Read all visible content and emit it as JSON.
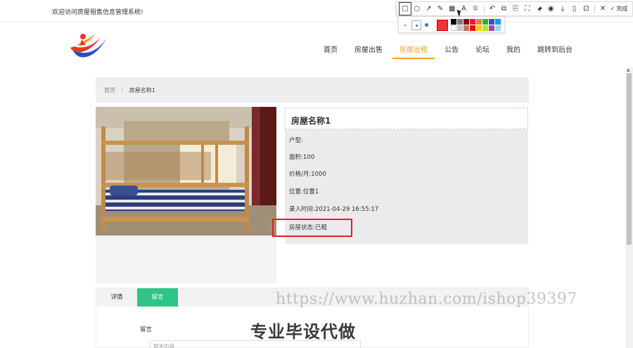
{
  "topbar": {
    "welcome": "欢迎访问房屋租售信息管理系统!"
  },
  "annotation_toolbar": {
    "tools": [
      {
        "name": "rectangle-icon",
        "glyph": "□"
      },
      {
        "name": "ellipse-icon",
        "glyph": "○"
      },
      {
        "name": "arrow-icon",
        "glyph": "↗"
      },
      {
        "name": "pen-icon",
        "glyph": "✎"
      },
      {
        "name": "mosaic-icon",
        "glyph": "▦"
      },
      {
        "name": "text-icon",
        "glyph": "A"
      },
      {
        "name": "number-icon",
        "glyph": "①"
      },
      {
        "name": "undo-icon",
        "glyph": "↶"
      },
      {
        "name": "crop-icon",
        "glyph": "⧉"
      },
      {
        "name": "ocr-icon",
        "glyph": "⎘"
      },
      {
        "name": "scan-icon",
        "glyph": "⛶"
      },
      {
        "name": "pin-icon",
        "glyph": "📌"
      },
      {
        "name": "record-icon",
        "glyph": "◉"
      },
      {
        "name": "download-icon",
        "glyph": "⤓"
      },
      {
        "name": "phone-icon",
        "glyph": "▯"
      },
      {
        "name": "save-icon",
        "glyph": "⊡"
      },
      {
        "name": "close-icon",
        "glyph": "✕"
      }
    ],
    "done_label": "完成",
    "done_glyph": "✓",
    "selected_color": "#e53935",
    "swatches": [
      "#000000",
      "#7f7f7f",
      "#880015",
      "#ed1c24",
      "#ff7f27",
      "#22b14c",
      "#3f48cc",
      "#00a2e8",
      "#ffffff",
      "#c3c3c3",
      "#b97a57",
      "#ff0000",
      "#ffc90e",
      "#b5e61d",
      "#a349a4",
      "#99d9ea"
    ]
  },
  "nav": {
    "items": [
      {
        "label": "首页",
        "active": false
      },
      {
        "label": "房屋出售",
        "active": false
      },
      {
        "label": "房屋出租",
        "active": true
      },
      {
        "label": "公告",
        "active": false
      },
      {
        "label": "论坛",
        "active": false
      },
      {
        "label": "我的",
        "active": false
      },
      {
        "label": "跳转到后台",
        "active": false
      }
    ]
  },
  "breadcrumb": {
    "home": "首页",
    "separator": "/",
    "current": "房屋名称1"
  },
  "house": {
    "title": "房屋名称1",
    "fields": [
      {
        "label": "户型:",
        "value": ""
      },
      {
        "label": "面积:",
        "value": "100"
      },
      {
        "label": "价格/月:",
        "value": "1000"
      },
      {
        "label": "位置:",
        "value": "位置1"
      },
      {
        "label": "录入时间:",
        "value": "2021-04-29 16:55:17"
      },
      {
        "label": "房屋状态:",
        "value": "已租"
      }
    ]
  },
  "tabs": {
    "details": "详情",
    "comments": "留言"
  },
  "comment_form": {
    "label": "留言",
    "placeholder": "留言内容"
  },
  "watermarks": {
    "url": "https://www.huzhan.com/ishop39397",
    "slogan": "专业毕设代做"
  },
  "colors": {
    "accent": "#f0a31a",
    "tab_active": "#2ec487",
    "highlight": "#e02020"
  }
}
